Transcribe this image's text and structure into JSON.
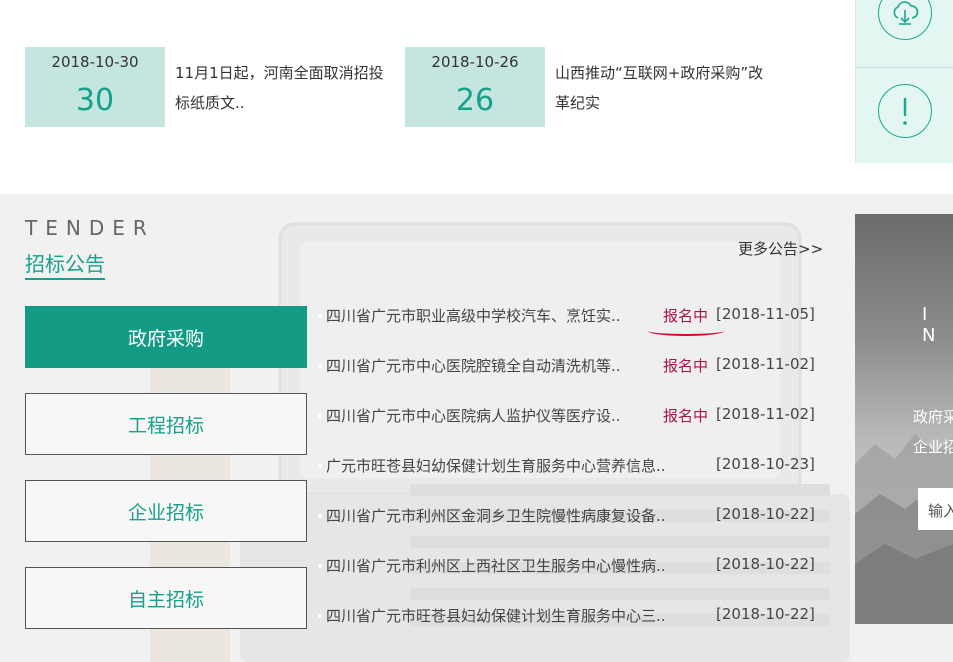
{
  "news": [
    {
      "date": "2018-10-30",
      "day": "30",
      "title": "11月1日起，河南全面取消招投标纸质文.."
    },
    {
      "date": "2018-10-26",
      "day": "26",
      "title": "山西推动“互联网+政府采购”改革纪实"
    }
  ],
  "tender": {
    "en_title": "TENDER",
    "cn_title": "招标公告",
    "more": "更多公告>>",
    "categories": [
      "政府采购",
      "工程招标",
      "企业招标",
      "自主招标"
    ],
    "items": [
      {
        "title": "四川省广元市职业高级中学校汽车、烹饪实..",
        "status": "报名中",
        "date": "[2018-11-05]"
      },
      {
        "title": "四川省广元市中心医院腔镜全自动清洗机等..",
        "status": "报名中",
        "date": "[2018-11-02]"
      },
      {
        "title": "四川省广元市中心医院病人监护仪等医疗设..",
        "status": "报名中",
        "date": "[2018-11-02]"
      },
      {
        "title": "广元市旺苍县妇幼保健计划生育服务中心营养信息..",
        "status": "",
        "date": "[2018-10-23]"
      },
      {
        "title": "四川省广元市利州区金洞乡卫生院慢性病康复设备..",
        "status": "",
        "date": "[2018-10-22]"
      },
      {
        "title": "四川省广元市利州区上西社区卫生服务中心慢性病..",
        "status": "",
        "date": "[2018-10-22]"
      },
      {
        "title": "四川省广元市旺苍县妇幼保健计划生育服务中心三..",
        "status": "",
        "date": "[2018-10-22]"
      }
    ]
  },
  "promo": {
    "letters": "I N",
    "line1": "政府采",
    "line2": "企业招",
    "input_placeholder": "输入"
  },
  "colors": {
    "accent": "#139b85",
    "status": "#a3174b",
    "mark": "#c8102e"
  },
  "icons": {
    "download": "cloud-download-icon",
    "alert": "exclamation-icon"
  }
}
